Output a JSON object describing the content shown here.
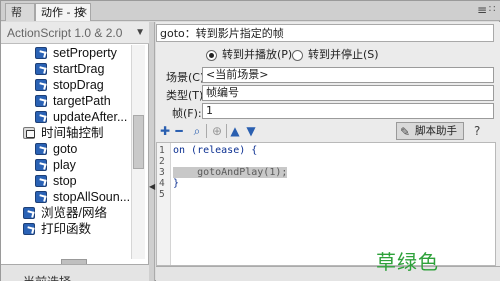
{
  "tabs": [
    {
      "label": "帮助"
    },
    {
      "label": "动作 - 按钮"
    }
  ],
  "left_panel": {
    "version_select": "ActionScript 1.0 & 2.0",
    "tree_items": [
      {
        "label": "setProperty",
        "kind": "child"
      },
      {
        "label": "startDrag",
        "kind": "child"
      },
      {
        "label": "stopDrag",
        "kind": "child"
      },
      {
        "label": "targetPath",
        "kind": "child"
      },
      {
        "label": "updateAfter...",
        "kind": "child"
      },
      {
        "label": "时间轴控制",
        "kind": "folder"
      },
      {
        "label": "goto",
        "kind": "child"
      },
      {
        "label": "play",
        "kind": "child"
      },
      {
        "label": "stop",
        "kind": "child"
      },
      {
        "label": "stopAllSoun...",
        "kind": "child"
      },
      {
        "label": "浏览器/网络",
        "kind": "book"
      },
      {
        "label": "打印函数",
        "kind": "book"
      }
    ],
    "scope_label": "当前选择"
  },
  "right_panel": {
    "title": "goto：转到影片指定的帧",
    "radio_options": [
      {
        "label": "转到并播放(P)",
        "checked": true
      },
      {
        "label": "转到并停止(S)",
        "checked": false
      }
    ],
    "fields": {
      "scene": {
        "label": "场景(C):",
        "value": "<当前场景>"
      },
      "type": {
        "label": "类型(T):",
        "value": "帧编号"
      },
      "frame": {
        "label": "帧(F):",
        "value": "1"
      }
    },
    "helper_button": "脚本助手",
    "code_lines": [
      {
        "num": "1",
        "text": "on (release) {"
      },
      {
        "num": "2",
        "text": ""
      },
      {
        "num": "3",
        "text": "    gotoAndPlay(1);"
      },
      {
        "num": "4",
        "text": "}"
      },
      {
        "num": "5",
        "text": ""
      }
    ]
  },
  "watermark": "草绿色"
}
